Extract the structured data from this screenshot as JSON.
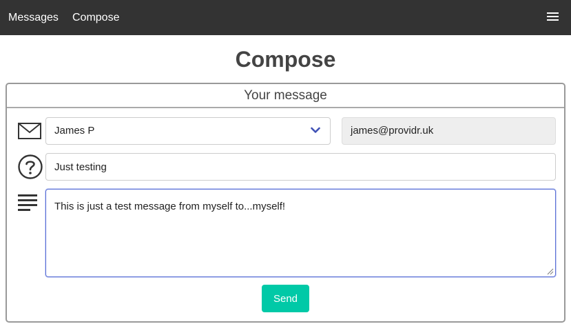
{
  "nav": {
    "messages_label": "Messages",
    "compose_label": "Compose",
    "menu_icon": "hamburger-menu-icon"
  },
  "page": {
    "title": "Compose"
  },
  "card": {
    "header": "Your message"
  },
  "form": {
    "recipient": {
      "selected": "James P",
      "icon": "envelope-icon"
    },
    "recipient_email": "james@providr.uk",
    "subject": {
      "value": "Just testing",
      "icon": "question-circle-icon"
    },
    "message": {
      "value": "This is just a test message from myself to...myself!",
      "icon": "text-lines-icon"
    },
    "send_label": "Send"
  },
  "colors": {
    "navbar": "#333333",
    "send_button": "#00c9a7",
    "chevron": "#3f51b5",
    "focus_border": "#5a6fd6"
  }
}
